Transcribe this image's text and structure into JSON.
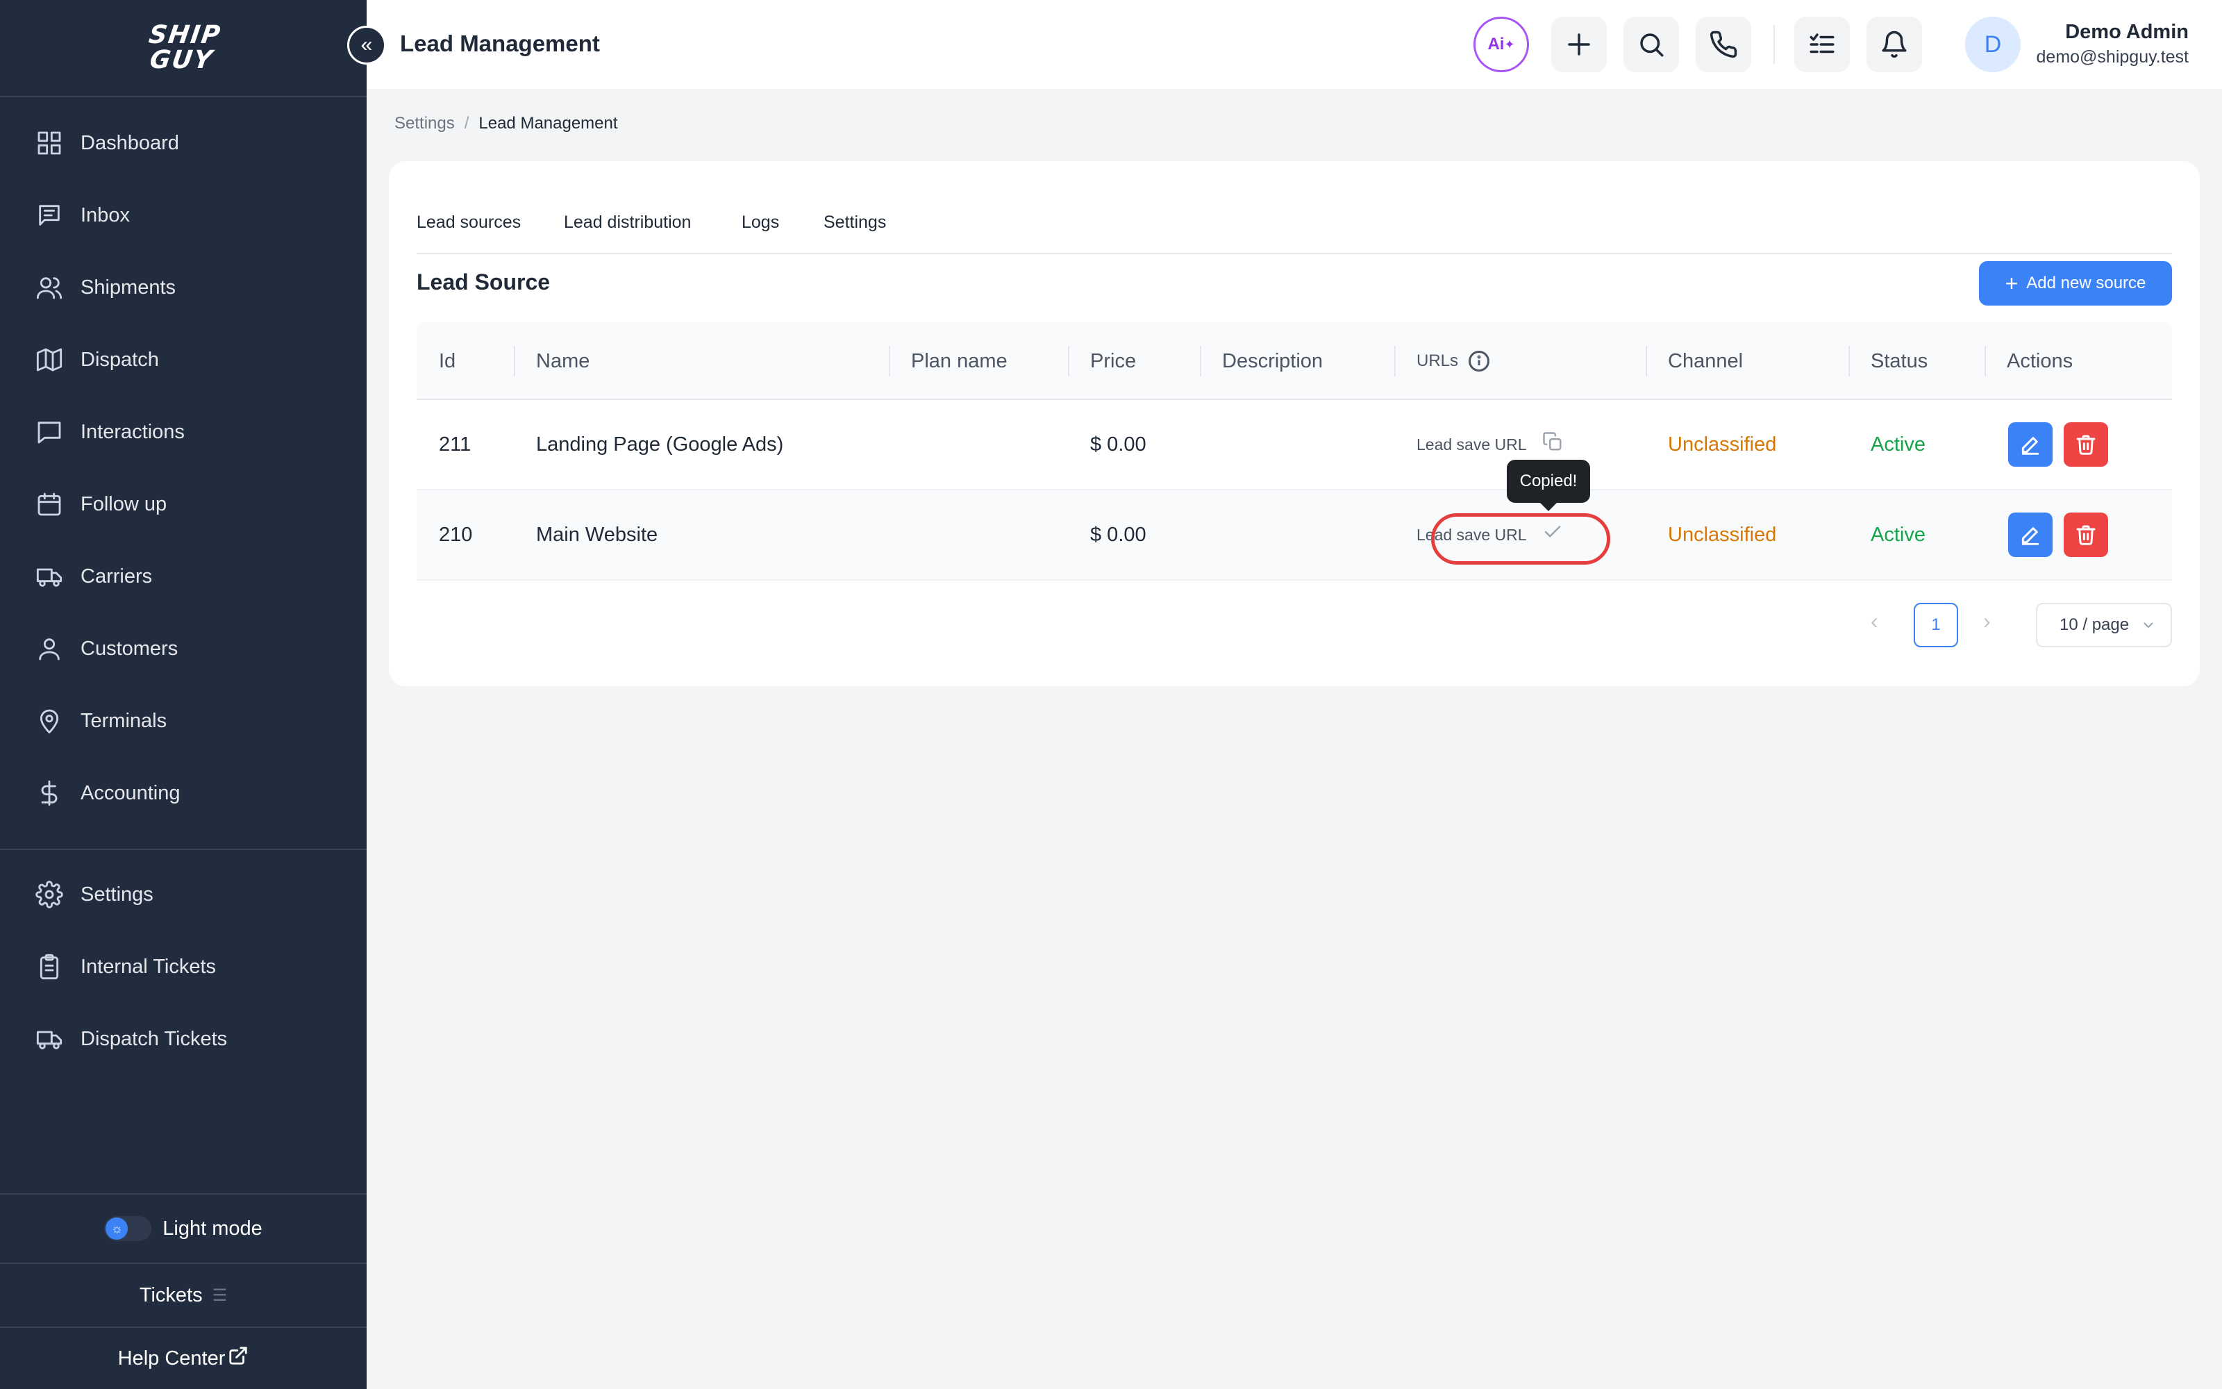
{
  "sidebar": {
    "logo_line1": "SHIP",
    "logo_line2": "GUY",
    "items": [
      {
        "label": "Dashboard",
        "icon": "grid-icon"
      },
      {
        "label": "Inbox",
        "icon": "message-square-icon"
      },
      {
        "label": "Shipments",
        "icon": "users-icon"
      },
      {
        "label": "Dispatch",
        "icon": "map-icon"
      },
      {
        "label": "Interactions",
        "icon": "chat-bubble-icon"
      },
      {
        "label": "Follow up",
        "icon": "calendar-icon"
      },
      {
        "label": "Carriers",
        "icon": "truck-icon"
      },
      {
        "label": "Customers",
        "icon": "user-icon"
      },
      {
        "label": "Terminals",
        "icon": "map-pin-icon"
      },
      {
        "label": "Accounting",
        "icon": "dollar-icon"
      }
    ],
    "secondary_items": [
      {
        "label": "Settings",
        "icon": "gear-icon"
      },
      {
        "label": "Internal Tickets",
        "icon": "clipboard-icon"
      },
      {
        "label": "Dispatch Tickets",
        "icon": "truck-icon"
      }
    ],
    "mode_label": "Light mode",
    "tickets_label": "Tickets",
    "help_label": "Help Center"
  },
  "header": {
    "title": "Lead Management",
    "ai_label": "Ai",
    "user_initial": "D",
    "user_name": "Demo Admin",
    "user_email": "demo@shipguy.test"
  },
  "breadcrumb": {
    "parent": "Settings",
    "separator": "/",
    "current": "Lead Management"
  },
  "tabs": [
    "Lead sources",
    "Lead distribution",
    "Logs",
    "Settings"
  ],
  "section": {
    "title": "Lead Source",
    "add_button": "Add new source"
  },
  "table": {
    "columns": [
      "Id",
      "Name",
      "Plan name",
      "Price",
      "Description",
      "URLs",
      "Channel",
      "Status",
      "Actions"
    ],
    "rows": [
      {
        "id": "211",
        "name": "Landing Page (Google Ads)",
        "plan": "",
        "price": "$ 0.00",
        "description": "",
        "url": "Lead save URL",
        "channel": "Unclassified",
        "status": "Active"
      },
      {
        "id": "210",
        "name": "Main Website",
        "plan": "",
        "price": "$ 0.00",
        "description": "",
        "url": "Lead save URL",
        "channel": "Unclassified",
        "status": "Active"
      }
    ]
  },
  "tooltip": "Copied!",
  "pagination": {
    "current": "1",
    "page_size": "10 / page",
    "prev": "‹",
    "next": "›"
  },
  "colors": {
    "sidebar_bg": "#222c3f",
    "accent": "#3b82f6",
    "danger": "#ef4444",
    "channel": "#d97706",
    "status_active": "#16a34a"
  }
}
